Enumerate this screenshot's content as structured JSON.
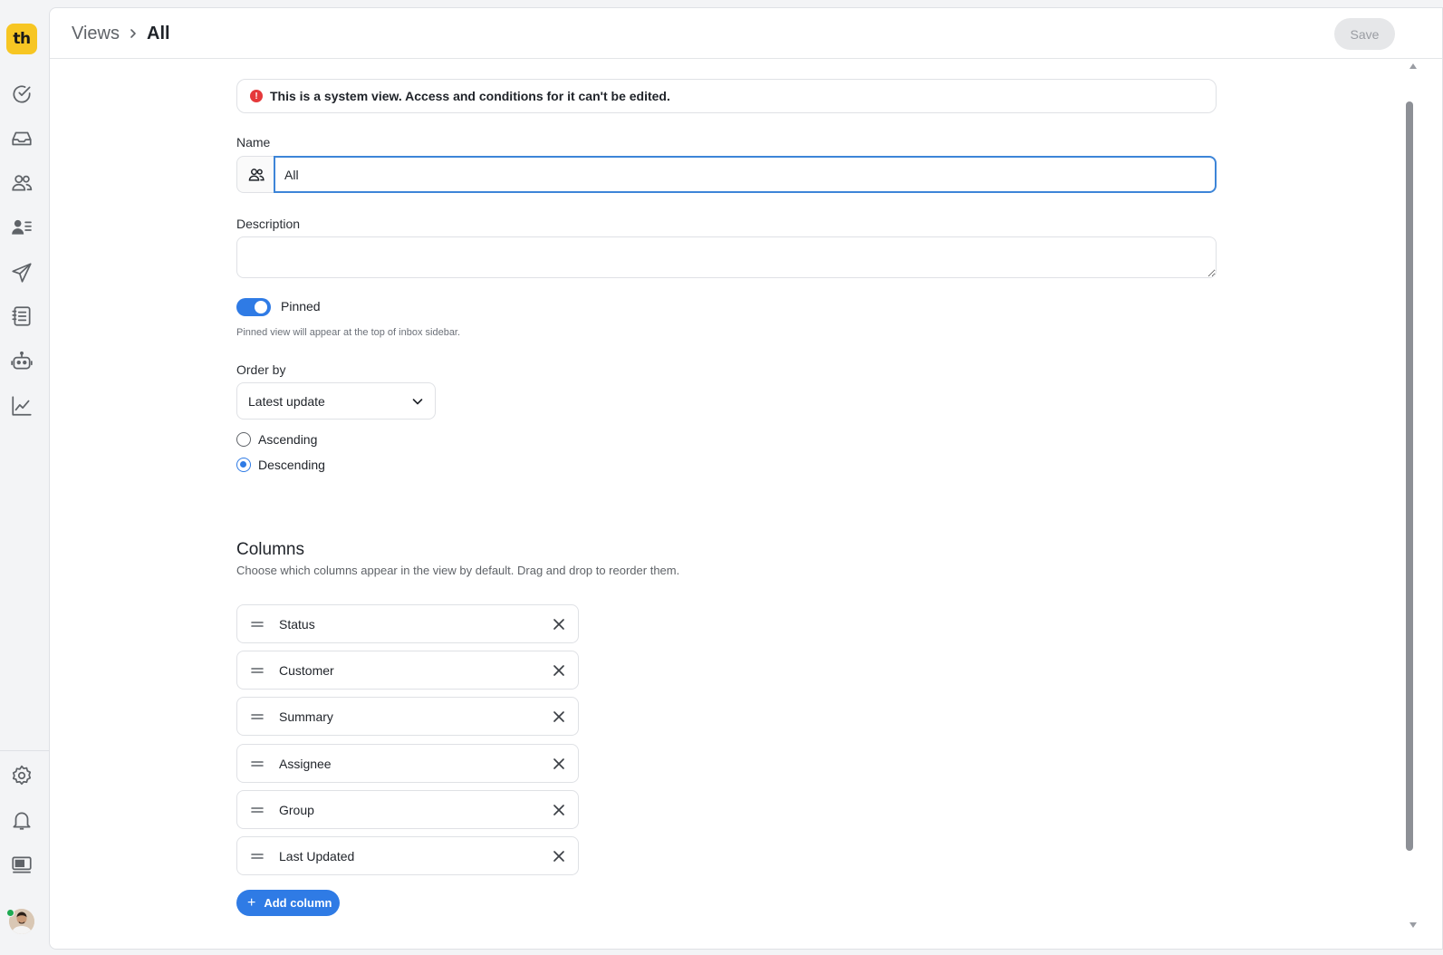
{
  "app": {
    "logo_text": "th"
  },
  "breadcrumb": {
    "root": "Views",
    "current": "All"
  },
  "toolbar": {
    "save_label": "Save"
  },
  "alert": {
    "text": "This is a system view. Access and conditions for it can't be edited.",
    "icon_text": "!"
  },
  "form": {
    "name_label": "Name",
    "name_value": "All",
    "description_label": "Description",
    "description_value": "",
    "pinned_label": "Pinned",
    "pinned": true,
    "pinned_help": "Pinned view will appear at the top of inbox sidebar.",
    "order_by_label": "Order by",
    "order_by_value": "Latest update",
    "sort_options": [
      {
        "label": "Ascending",
        "checked": false
      },
      {
        "label": "Descending",
        "checked": true
      }
    ]
  },
  "columns": {
    "title": "Columns",
    "subtitle": "Choose which columns appear in the view by default. Drag and drop to reorder them.",
    "items": [
      {
        "label": "Status"
      },
      {
        "label": "Customer"
      },
      {
        "label": "Summary"
      },
      {
        "label": "Assignee"
      },
      {
        "label": "Group"
      },
      {
        "label": "Last Updated"
      }
    ],
    "add_label": "Add column"
  },
  "sidebar": {
    "top_icons": [
      "check-circle-icon",
      "inbox-icon",
      "users-icon",
      "contacts-icon",
      "send-icon",
      "document-list-icon",
      "bot-icon",
      "analytics-icon"
    ],
    "bottom_icons": [
      "gear-icon",
      "bell-icon",
      "billing-icon"
    ]
  },
  "colors": {
    "accent": "#2f7be5",
    "brand": "#f7c623",
    "alert": "#e5393b",
    "online": "#1eaa52"
  }
}
